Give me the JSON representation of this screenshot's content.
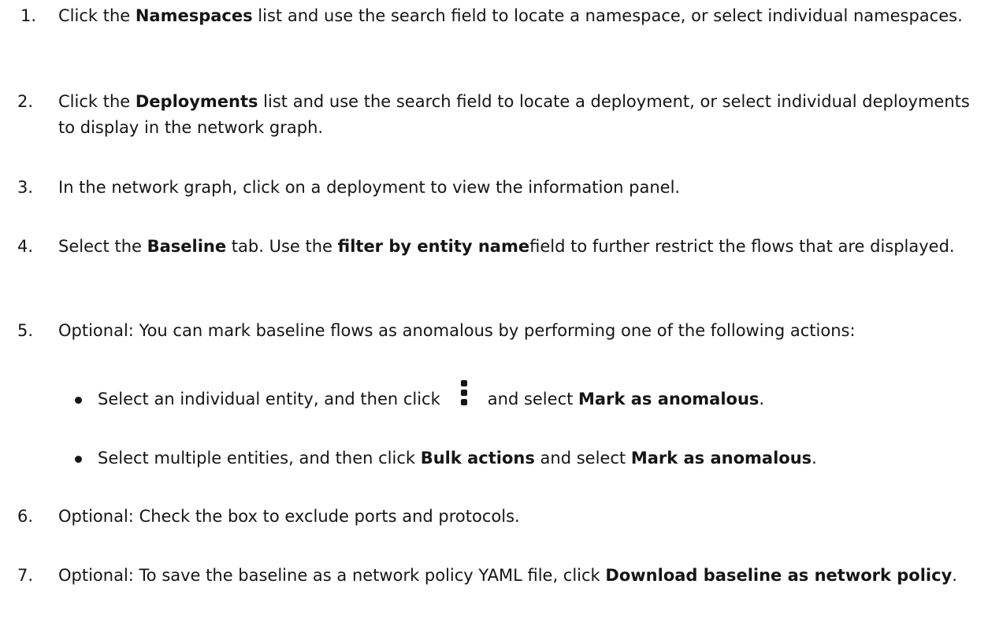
{
  "steps": [
    {
      "num": "1.",
      "pre": "Click the ",
      "bold": "Namespaces",
      "post": " list and use the search field to locate a namespace, or select individual namespaces."
    },
    {
      "num": "2.",
      "pre": "Click the ",
      "bold": "Deployments",
      "post": " list and use the search field to locate a deployment, or select individual deployments to display in the network graph."
    },
    {
      "num": "3.",
      "text": "In the network graph, click on a deployment to view the information panel."
    },
    {
      "num": "4.",
      "pre": "Select the ",
      "bold": "Baseline",
      "mid": " tab. Use the ",
      "bold2": "filter by entity name",
      "post": "field to further restrict the flows that are displayed."
    },
    {
      "num": "5.",
      "text": "Optional: You can mark baseline flows as anomalous by performing one of the following actions:"
    },
    {
      "num": "6.",
      "text": "Optional: Check the box to exclude ports and protocols."
    },
    {
      "num": "7.",
      "pre": "Optional: To save the baseline as a network policy YAML file, click ",
      "bold": "Download baseline as network policy",
      "post": "."
    }
  ],
  "substeps": [
    {
      "pre": "Select an individual entity, and then click",
      "icon": "kebab-menu-icon",
      "mid": "and select ",
      "bold": "Mark as anomalous",
      "post": "."
    },
    {
      "pre": "Select multiple entities, and then click ",
      "bold": "Bulk actions",
      "mid": " and select ",
      "bold2": "Mark as anomalous",
      "post": "."
    }
  ]
}
